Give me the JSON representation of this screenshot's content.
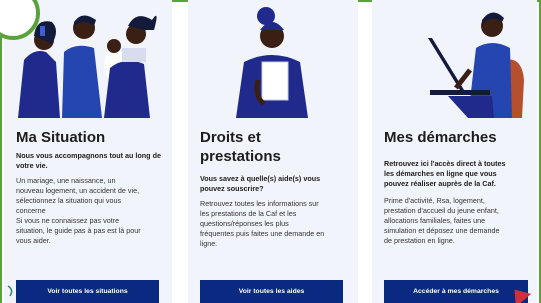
{
  "cards": [
    {
      "title": "Ma Situation",
      "intro": "Nous vous accompagnons tout au long de votre vie.",
      "body_lines": [
        "Un mariage, une naissance, un",
        "nouveau logement, un accident de vie,",
        "sélectionnez la situation qui vous",
        "concerne",
        "Si vous ne connaissez pas votre",
        "situation, le guide pas à pas est là pour",
        "vous aider."
      ],
      "button": "Voir toutes les situations"
    },
    {
      "title_lines": [
        "Droits et",
        "prestations"
      ],
      "intro_lines": [
        "Vous savez à quelle(s) aide(s) vous",
        "pouvez souscrire?"
      ],
      "body_lines": [
        "Retrouvez toutes les informations sur",
        "les prestations de la Caf et les",
        "questions/réponses les plus",
        "fréquentes puis faites une demande en",
        "ligne."
      ],
      "button": "Voir toutes les aides"
    },
    {
      "title": "Mes démarches",
      "intro_lines": [
        "Retrouvez ici l'accès direct à toutes",
        "les démarches en ligne que vous",
        "pouvez réaliser auprès de la Caf."
      ],
      "body_lines": [
        "Prime d'activité, Rsa, logement,",
        "prestation d'accueil du jeune enfant,",
        "allocations familiales, faites une",
        "simulation et déposez une demande",
        "de prestation en ligne."
      ],
      "button": "Accéder à mes démarches"
    }
  ],
  "colors": {
    "navy": "#0a2a82",
    "card_bg": "#f2f4fb",
    "accent_green": "#5aa33c",
    "accent_red": "#d0303a",
    "illus_blue": "#2546b0",
    "illus_skin": "#3a1f14"
  },
  "icons": [
    "family-illustration",
    "woman-reading-illustration",
    "man-laptop-illustration",
    "cursor-arrow-icon"
  ]
}
